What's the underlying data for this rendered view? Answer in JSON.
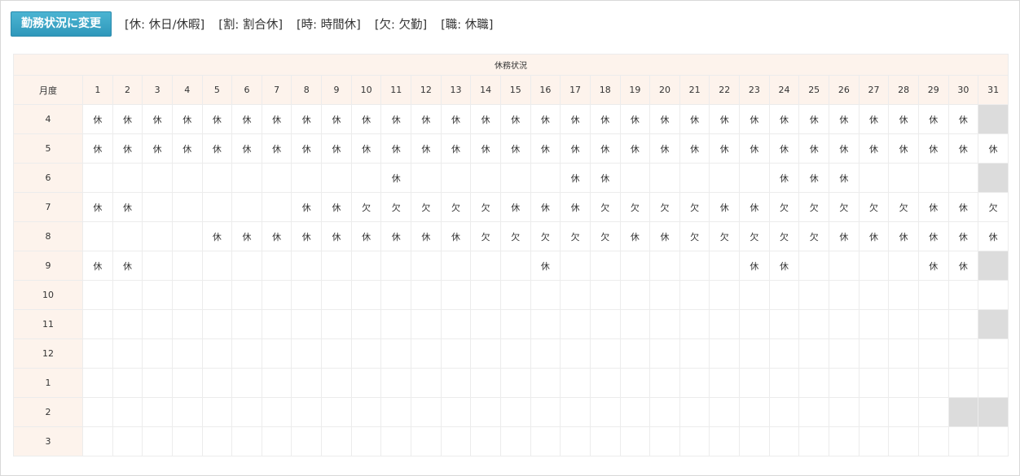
{
  "toolbar": {
    "change_button_label": "勤務状況に変更",
    "legend": [
      "[休: 休日/休暇]",
      "[割: 割合休]",
      "[時: 時間休]",
      "[欠: 欠勤]",
      "[職: 休職]"
    ]
  },
  "table": {
    "group_header": "休務状況",
    "month_header": "月度",
    "days": [
      "1",
      "2",
      "3",
      "4",
      "5",
      "6",
      "7",
      "8",
      "9",
      "10",
      "11",
      "12",
      "13",
      "14",
      "15",
      "16",
      "17",
      "18",
      "19",
      "20",
      "21",
      "22",
      "23",
      "24",
      "25",
      "26",
      "27",
      "28",
      "29",
      "30",
      "31"
    ],
    "rows": [
      {
        "month": "4",
        "days": 30,
        "cells": [
          "休",
          "休",
          "休",
          "休",
          "休",
          "休",
          "休",
          "休",
          "休",
          "休",
          "休",
          "休",
          "休",
          "休",
          "休",
          "休",
          "休",
          "休",
          "休",
          "休",
          "休",
          "休",
          "休",
          "休",
          "休",
          "休",
          "休",
          "休",
          "休",
          "休"
        ]
      },
      {
        "month": "5",
        "days": 31,
        "cells": [
          "休",
          "休",
          "休",
          "休",
          "休",
          "休",
          "休",
          "休",
          "休",
          "休",
          "休",
          "休",
          "休",
          "休",
          "休",
          "休",
          "休",
          "休",
          "休",
          "休",
          "休",
          "休",
          "休",
          "休",
          "休",
          "休",
          "休",
          "休",
          "休",
          "休",
          "休"
        ]
      },
      {
        "month": "6",
        "days": 30,
        "cells": [
          "",
          "",
          "",
          "",
          "",
          "",
          "",
          "",
          "",
          "",
          "休",
          "",
          "",
          "",
          "",
          "",
          "休",
          "休",
          "",
          "",
          "",
          "",
          "",
          "休",
          "休",
          "休",
          "",
          "",
          "",
          ""
        ]
      },
      {
        "month": "7",
        "days": 31,
        "cells": [
          "休",
          "休",
          "",
          "",
          "",
          "",
          "",
          "休",
          "休",
          "欠",
          "欠",
          "欠",
          "欠",
          "欠",
          "休",
          "休",
          "休",
          "欠",
          "欠",
          "欠",
          "欠",
          "休",
          "休",
          "欠",
          "欠",
          "欠",
          "欠",
          "欠",
          "休",
          "休",
          "欠"
        ]
      },
      {
        "month": "8",
        "days": 31,
        "cells": [
          "",
          "",
          "",
          "",
          "休",
          "休",
          "休",
          "休",
          "休",
          "休",
          "休",
          "休",
          "休",
          "欠",
          "欠",
          "欠",
          "欠",
          "欠",
          "休",
          "休",
          "欠",
          "欠",
          "欠",
          "欠",
          "欠",
          "休",
          "休",
          "休",
          "休",
          "休",
          "休"
        ]
      },
      {
        "month": "9",
        "days": 30,
        "cells": [
          "休",
          "休",
          "",
          "",
          "",
          "",
          "",
          "",
          "",
          "",
          "",
          "",
          "",
          "",
          "",
          "休",
          "",
          "",
          "",
          "",
          "",
          "",
          "休",
          "休",
          "",
          "",
          "",
          "",
          "休",
          "休"
        ]
      },
      {
        "month": "10",
        "days": 31,
        "cells": [
          "",
          "",
          "",
          "",
          "",
          "",
          "",
          "",
          "",
          "",
          "",
          "",
          "",
          "",
          "",
          "",
          "",
          "",
          "",
          "",
          "",
          "",
          "",
          "",
          "",
          "",
          "",
          "",
          "",
          "",
          ""
        ]
      },
      {
        "month": "11",
        "days": 30,
        "cells": [
          "",
          "",
          "",
          "",
          "",
          "",
          "",
          "",
          "",
          "",
          "",
          "",
          "",
          "",
          "",
          "",
          "",
          "",
          "",
          "",
          "",
          "",
          "",
          "",
          "",
          "",
          "",
          "",
          "",
          ""
        ]
      },
      {
        "month": "12",
        "days": 31,
        "cells": [
          "",
          "",
          "",
          "",
          "",
          "",
          "",
          "",
          "",
          "",
          "",
          "",
          "",
          "",
          "",
          "",
          "",
          "",
          "",
          "",
          "",
          "",
          "",
          "",
          "",
          "",
          "",
          "",
          "",
          "",
          ""
        ]
      },
      {
        "month": "1",
        "days": 31,
        "cells": [
          "",
          "",
          "",
          "",
          "",
          "",
          "",
          "",
          "",
          "",
          "",
          "",
          "",
          "",
          "",
          "",
          "",
          "",
          "",
          "",
          "",
          "",
          "",
          "",
          "",
          "",
          "",
          "",
          "",
          "",
          ""
        ]
      },
      {
        "month": "2",
        "days": 29,
        "cells": [
          "",
          "",
          "",
          "",
          "",
          "",
          "",
          "",
          "",
          "",
          "",
          "",
          "",
          "",
          "",
          "",
          "",
          "",
          "",
          "",
          "",
          "",
          "",
          "",
          "",
          "",
          "",
          "",
          ""
        ]
      },
      {
        "month": "3",
        "days": 31,
        "cells": [
          "",
          "",
          "",
          "",
          "",
          "",
          "",
          "",
          "",
          "",
          "",
          "",
          "",
          "",
          "",
          "",
          "",
          "",
          "",
          "",
          "",
          "",
          "",
          "",
          "",
          "",
          "",
          "",
          "",
          "",
          ""
        ]
      }
    ]
  }
}
